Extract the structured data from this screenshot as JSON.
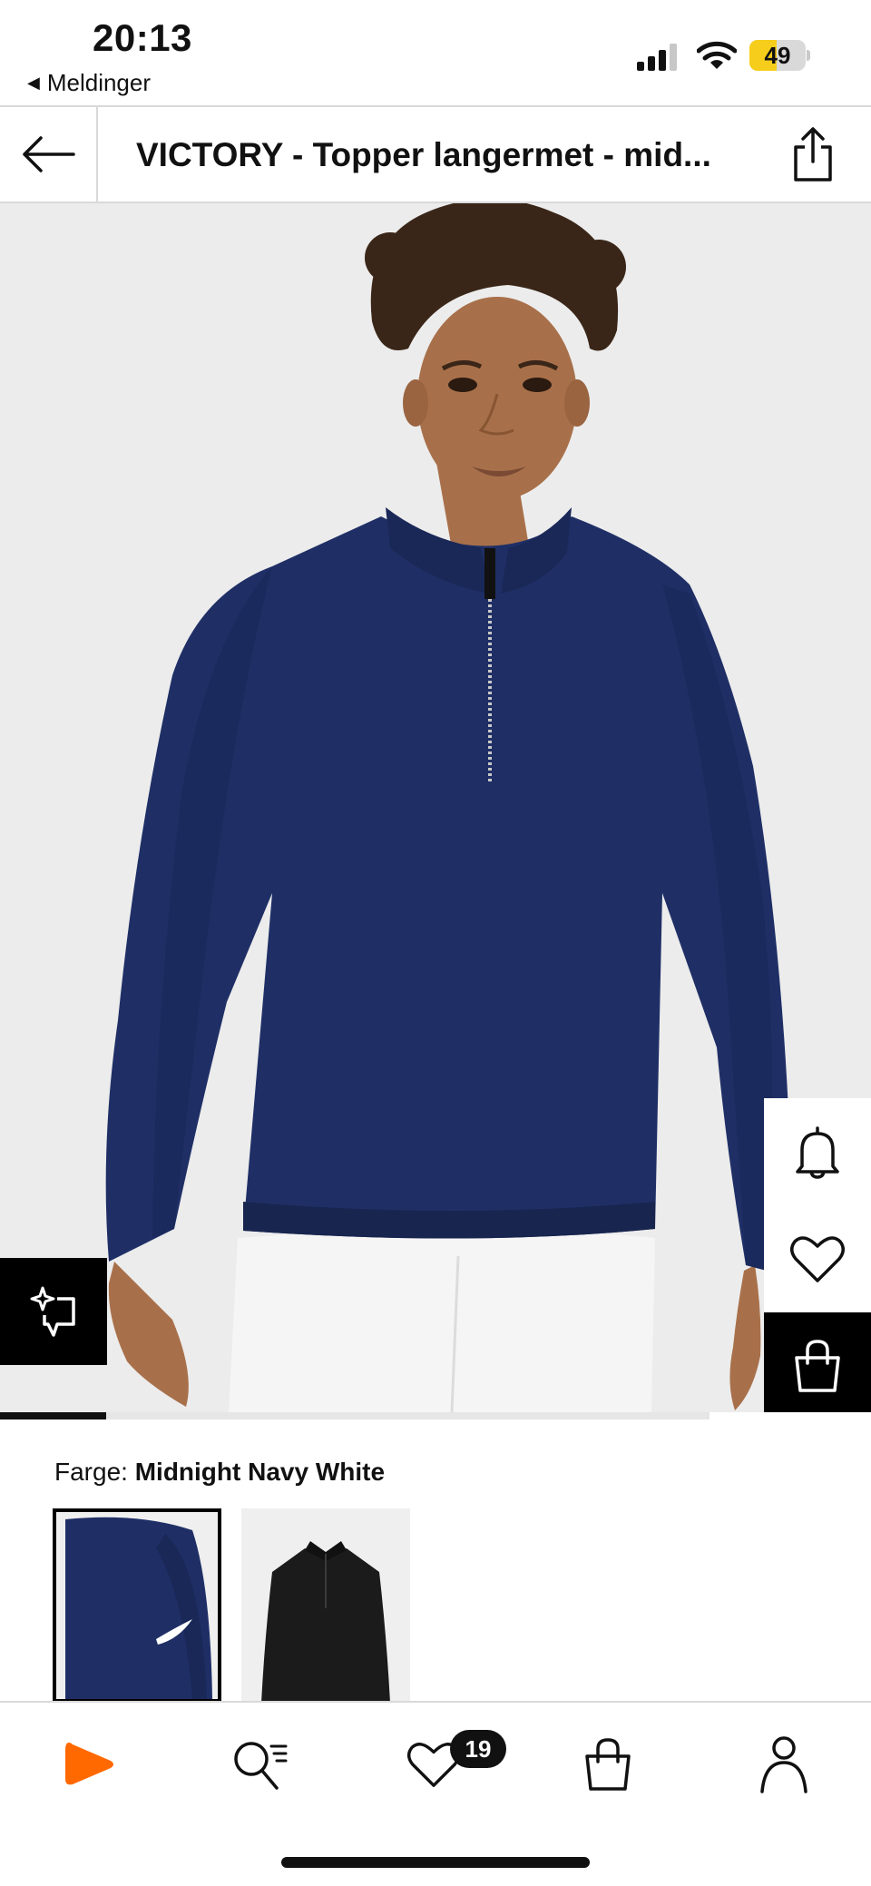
{
  "status_bar": {
    "time": "20:13",
    "back_app": "Meldinger",
    "battery_pct": "49",
    "battery_level": 0.49,
    "battery_color": "#f6cd1a"
  },
  "header": {
    "title": "VICTORY - Topper langermet - mid..."
  },
  "gallery": {
    "progress": 0.15
  },
  "color": {
    "label": "Farge:",
    "name": "Midnight Navy White"
  },
  "swatches": [
    {
      "name": "Midnight Navy White",
      "color": "#1f2f66",
      "selected": true
    },
    {
      "name": "Black",
      "color": "#1b1b1b",
      "selected": false
    }
  ],
  "icons": {
    "back": "arrow-left-icon",
    "share": "share-icon",
    "similar": "sparkle-crop-icon",
    "notify": "bell-icon",
    "wishlist": "heart-icon",
    "bag": "shopping-bag-icon"
  },
  "bottom_nav": {
    "home": "home-logo-icon",
    "search": "search-icon",
    "wishlist": "heart-icon",
    "wishlist_count": "19",
    "bag": "shopping-bag-icon",
    "profile": "profile-icon"
  },
  "colors": {
    "brand": "#ff6900",
    "garment": "#1f2f66",
    "image_bg": "#ececec"
  }
}
